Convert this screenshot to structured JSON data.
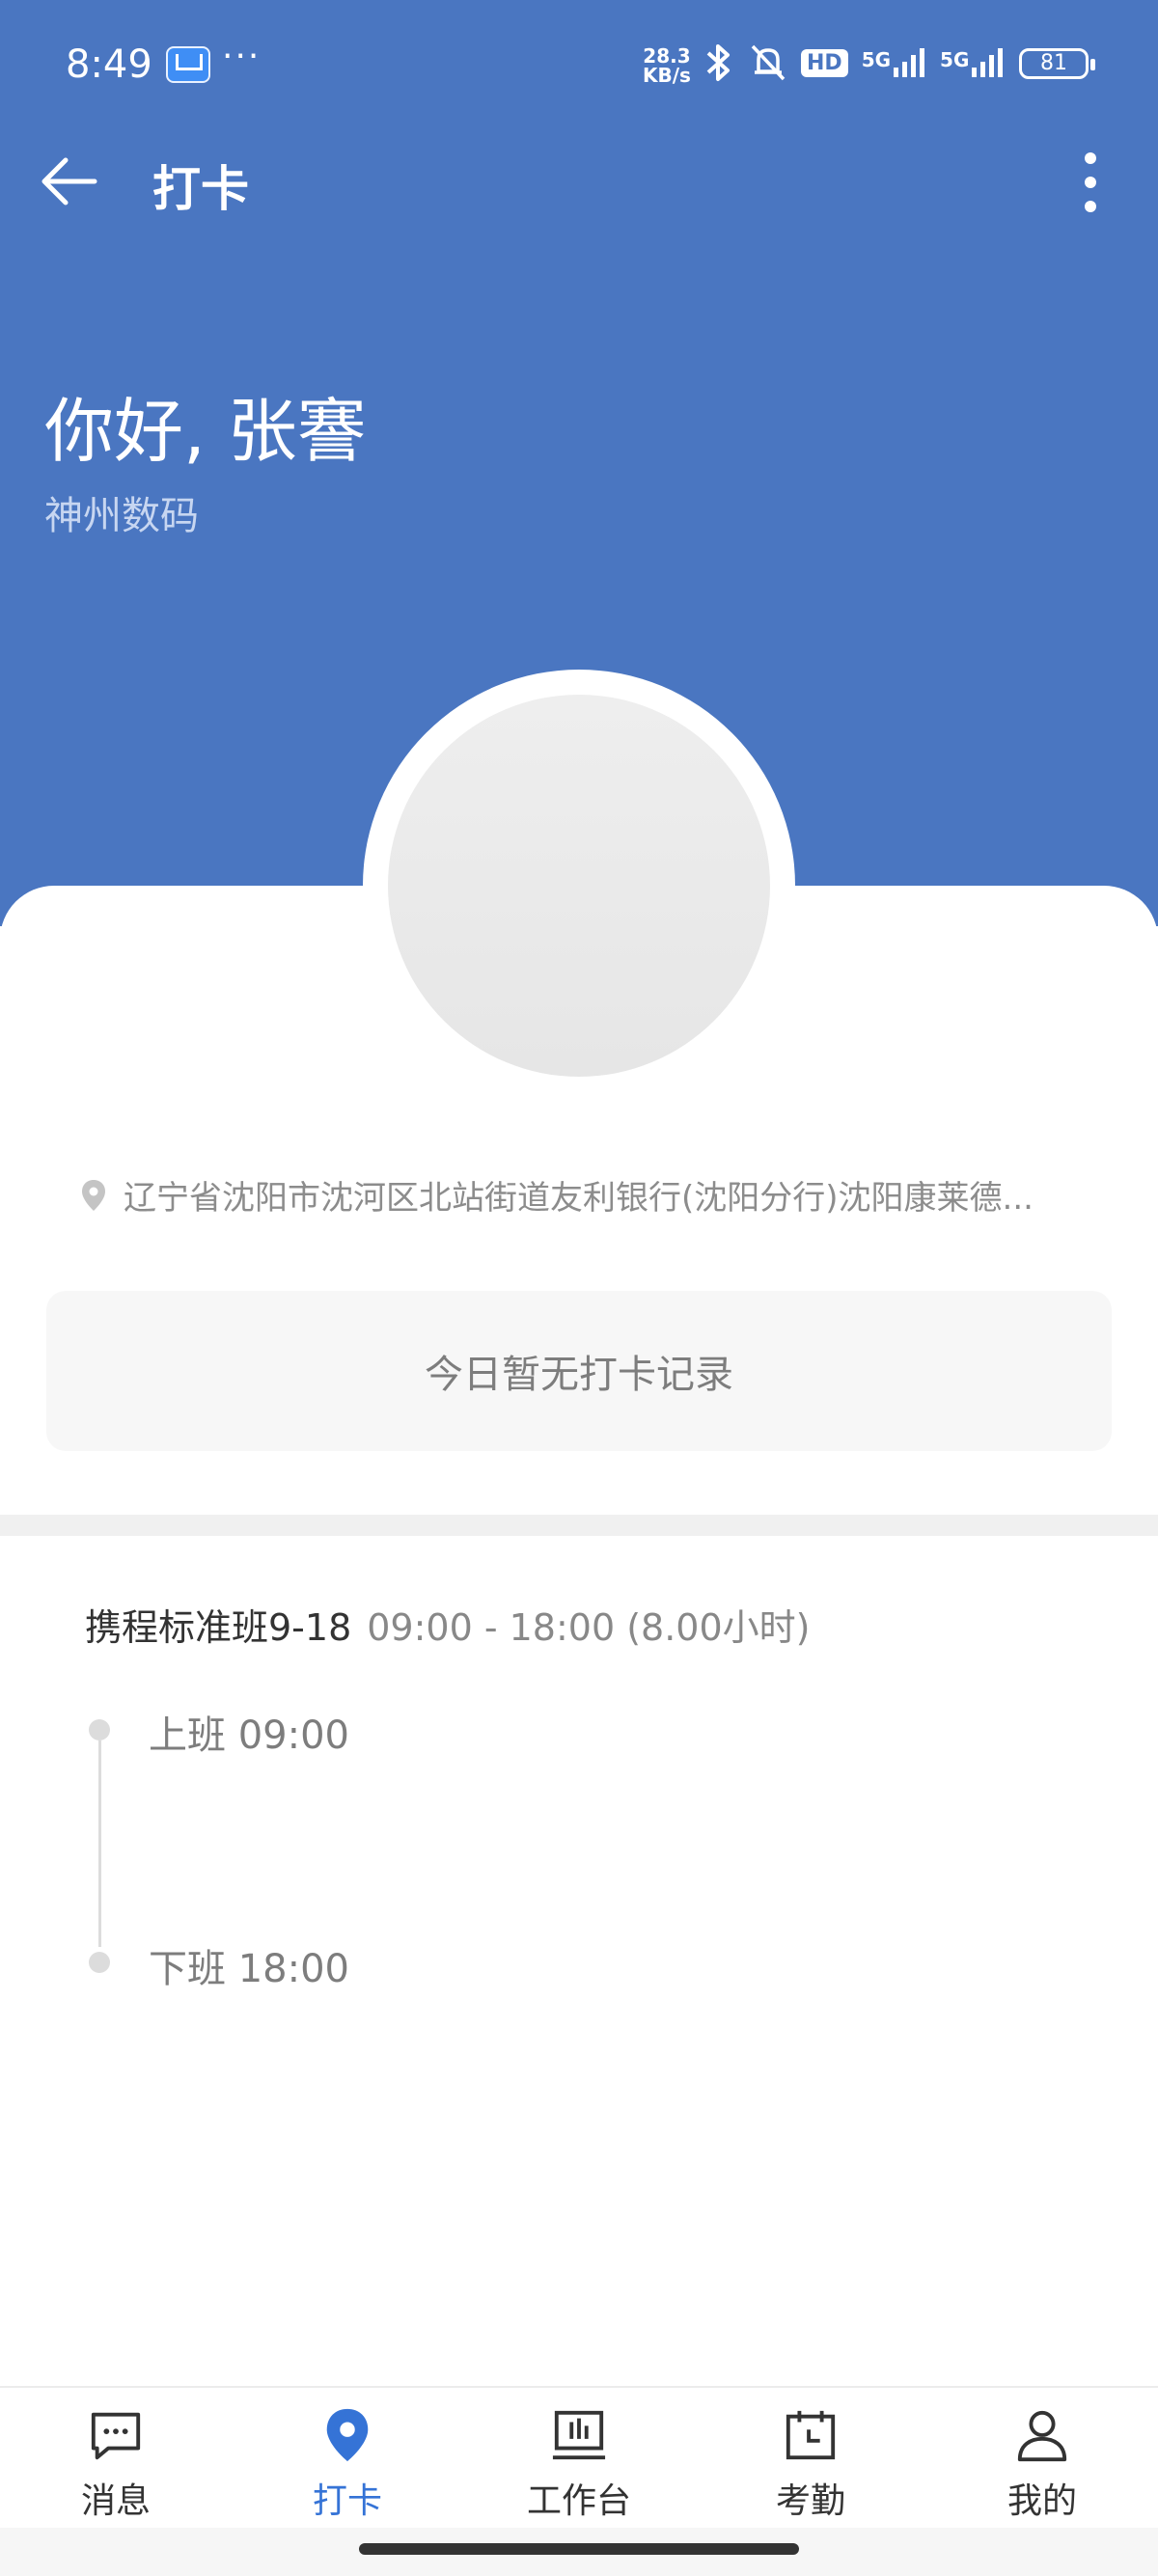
{
  "status_bar": {
    "time": "8:49",
    "more": "···",
    "net_speed_value": "28.3",
    "net_speed_unit": "KB/s",
    "hd_badge": "HD",
    "signal_1": "5G",
    "signal_2": "5G",
    "battery": "81"
  },
  "header": {
    "title": "打卡",
    "greeting": "你好, 张謇",
    "company": "神州数码"
  },
  "location": {
    "address": "辽宁省沈阳市沈河区北站街道友利银行(沈阳分行)沈阳康莱德..."
  },
  "record": {
    "empty_text": "今日暂无打卡记录"
  },
  "shift": {
    "name": "携程标准班9-18",
    "time_range": "09:00 - 18:00 (8.00小时)",
    "start_label": "上班 09:00",
    "end_label": "下班 18:00"
  },
  "tabbar": {
    "items": [
      {
        "label": "消息",
        "icon": "message-icon"
      },
      {
        "label": "打卡",
        "icon": "location-pin-icon",
        "active": true
      },
      {
        "label": "工作台",
        "icon": "workbench-icon"
      },
      {
        "label": "考勤",
        "icon": "calendar-icon"
      },
      {
        "label": "我的",
        "icon": "user-icon"
      }
    ]
  },
  "colors": {
    "header_blue": "#4a76c1",
    "active_tab": "#3573d6"
  }
}
